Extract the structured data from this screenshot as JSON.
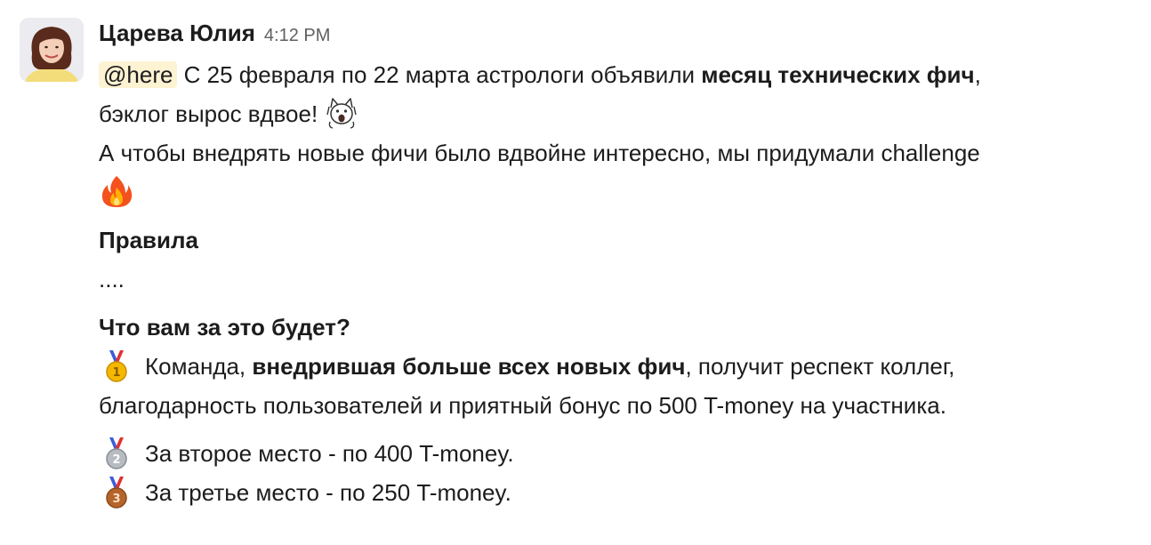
{
  "message": {
    "author": "Царева Юлия",
    "time": "4:12 PM",
    "mention": "@here",
    "intro": {
      "pre": " С 25 февраля по 22 марта астрологи объявили ",
      "bold": "месяц технических фич",
      "post": ",",
      "line2": "бэклог вырос вдвое! ",
      "line3": "А чтобы внедрять новые фичи было вдвойне интересно, мы придумали challenge"
    },
    "rules_heading": "Правила",
    "rules_body": "....",
    "reward_heading": "Что вам за это будет?",
    "first_place": {
      "pre": "Команда, ",
      "bold": "внедрившая больше всех новых фич",
      "post": ", получит респект коллег,",
      "line2": "благодарность пользователей и приятный бонус по 500 T-money на участника."
    },
    "second_place": "За второе место - по 400 T-money.",
    "third_place": "За третье место - по 250 T-money.",
    "emojis": [
      "scream-cat-emoji",
      "fire-emoji",
      "first-place-medal",
      "second-place-medal",
      "third-place-medal"
    ],
    "colors": {
      "mention_bg": "#fdf3d3",
      "text": "#1d1c1d",
      "timestamp": "#616061"
    }
  }
}
